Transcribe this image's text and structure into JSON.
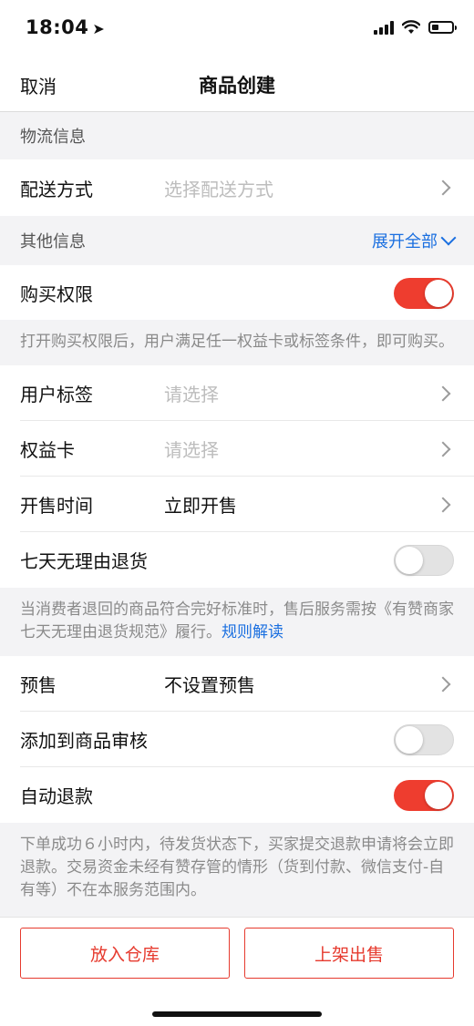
{
  "status_bar": {
    "time": "18:04",
    "battery_level": 0.35
  },
  "nav": {
    "cancel_label": "取消",
    "title": "商品创建"
  },
  "logistics": {
    "header": "物流信息",
    "delivery": {
      "label": "配送方式",
      "placeholder": "选择配送方式"
    }
  },
  "other": {
    "header": "其他信息",
    "expand_label": "展开全部",
    "purchase_permission": {
      "label": "购买权限",
      "enabled": true
    },
    "purchase_hint": "打开购买权限后，用户满足任一权益卡或标签条件，即可购买。",
    "user_tag": {
      "label": "用户标签",
      "placeholder": "请选择"
    },
    "benefit_card": {
      "label": "权益卡",
      "placeholder": "请选择"
    },
    "sale_time": {
      "label": "开售时间",
      "value": "立即开售"
    },
    "seven_day_return": {
      "label": "七天无理由退货",
      "enabled": false
    },
    "return_hint": "当消费者退回的商品符合完好标准时，售后服务需按《有赞商家七天无理由退货规范》履行。",
    "return_hint_link": "规则解读",
    "presale": {
      "label": "预售",
      "value": "不设置预售"
    },
    "add_to_review": {
      "label": "添加到商品审核",
      "enabled": false
    },
    "auto_refund": {
      "label": "自动退款",
      "enabled": true
    },
    "refund_hint": "下单成功６小时内，待发货状态下，买家提交退款申请将会立即退款。交易资金未经有赞存管的情形（货到付款、微信支付-自有等）不在本服务范围内。"
  },
  "footer": {
    "warehouse_label": "放入仓库",
    "publish_label": "上架出售"
  },
  "colors": {
    "accent": "#ee3d2f",
    "link": "#1a6fe0"
  }
}
